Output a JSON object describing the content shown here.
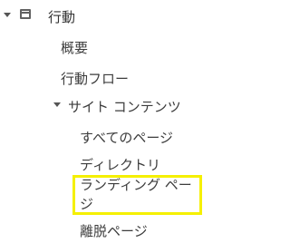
{
  "nav": {
    "section": {
      "label": "行動",
      "icon": "behavior-report-icon"
    },
    "items": [
      {
        "label": "概要"
      },
      {
        "label": "行動フロー"
      }
    ],
    "subsection": {
      "label": "サイト コンテンツ",
      "items": [
        {
          "label": "すべてのページ"
        },
        {
          "label": "ディレクトリ"
        },
        {
          "label": "ランディング ページ"
        },
        {
          "label": "離脱ページ"
        }
      ]
    }
  },
  "colors": {
    "highlight": "#f5f000",
    "text": "#3c3c3c",
    "icon": "#616161"
  }
}
